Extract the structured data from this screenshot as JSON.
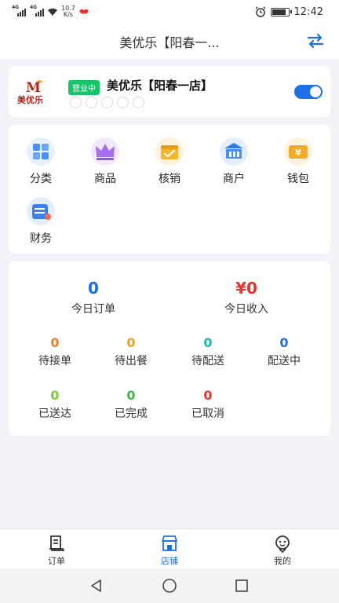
{
  "status_bar": {
    "signal_tag_1": "4G",
    "signal_tag_2": "4G",
    "speed_value": "10.7",
    "speed_unit": "K/s",
    "time": "12:42",
    "battery_level": 0.85
  },
  "header": {
    "title": "美优乐【阳春一..."
  },
  "store": {
    "logo_text": "美优乐",
    "status_badge": "营业中",
    "name": "美优乐【阳春一店】",
    "rating_empty_count": 5,
    "open_toggle_on": true
  },
  "menu": [
    {
      "label": "分类",
      "icon": "category-icon"
    },
    {
      "label": "商品",
      "icon": "crown-icon"
    },
    {
      "label": "核销",
      "icon": "verify-calendar-icon"
    },
    {
      "label": "商户",
      "icon": "merchant-bank-icon"
    },
    {
      "label": "钱包",
      "icon": "wallet-yen-icon"
    },
    {
      "label": "财务",
      "icon": "finance-card-icon"
    }
  ],
  "stats": {
    "today_orders": {
      "value": "0",
      "label": "今日订单"
    },
    "today_income": {
      "value": "¥0",
      "label": "今日收入"
    },
    "pending_accept": {
      "value": "0",
      "label": "待接单"
    },
    "pending_cook": {
      "value": "0",
      "label": "待出餐"
    },
    "pending_delivery": {
      "value": "0",
      "label": "待配送"
    },
    "delivering": {
      "value": "0",
      "label": "配送中"
    },
    "delivered": {
      "value": "0",
      "label": "已送达"
    },
    "completed": {
      "value": "0",
      "label": "已完成"
    },
    "cancelled": {
      "value": "0",
      "label": "已取消"
    }
  },
  "tabbar": [
    {
      "label": "订单",
      "icon": "order-icon"
    },
    {
      "label": "店铺",
      "icon": "shop-icon"
    },
    {
      "label": "我的",
      "icon": "profile-icon"
    }
  ],
  "colors": {
    "accent": "#1e6fe6",
    "open_green": "#16c46a",
    "red": "#e8342e",
    "orange": "#f07a2a",
    "teal": "#1cb5b0",
    "blue": "#1e6fe6",
    "green": "#3fb54a",
    "lime": "#7ec83b"
  }
}
